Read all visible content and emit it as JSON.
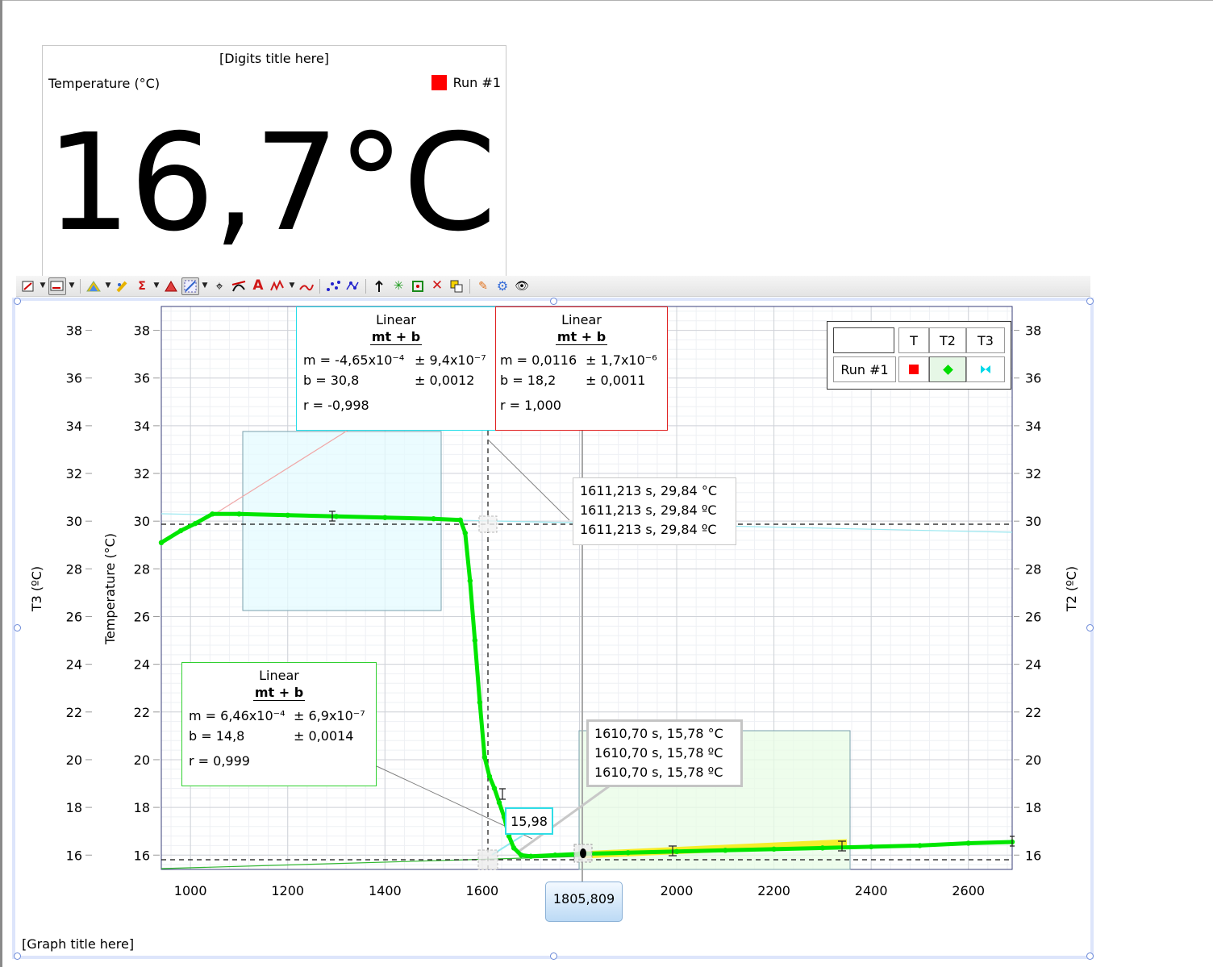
{
  "digits": {
    "title": "[Digits title here]",
    "label": "Temperature (°C)",
    "legend": "Run #1",
    "legend_color": "#ff0000",
    "value": "16,7°C"
  },
  "toolbar": {
    "icons": [
      "graph-options-icon",
      "autoscale-icon",
      "triangle-icon",
      "highlight-icon",
      "sigma-icon",
      "delta-icon",
      "select-region-icon",
      "crosshair-icon",
      "tangent-icon",
      "annotation-icon",
      "curve-fit-icon",
      "integral-icon",
      "show-data-icon",
      "connect-points-icon",
      "move-up-icon",
      "strip-chart-icon",
      "delete-icon",
      "copy-icon",
      "pin-icon",
      "settings-icon",
      "view-icon"
    ]
  },
  "graph": {
    "title": "[Graph title here]",
    "left_axis1_label": "T3 (ºC)",
    "left_axis2_label": "Temperature (°C)",
    "right_axis_label": "T2 (ºC)",
    "x_badge": "1805,809",
    "value_label": "15,98"
  },
  "fit_cyan": {
    "head": "Linear",
    "form": "mt + b",
    "m_label": "m = -4,65x10⁻⁴",
    "m_err": "± 9,4x10⁻⁷",
    "b_label": "b  = 30,8",
    "b_err": "± 0,0012",
    "r": "r = -0,998"
  },
  "fit_red": {
    "head": "Linear",
    "form": "mt + b",
    "m_label": "m = 0,0116",
    "m_err": "± 1,7x10⁻⁶",
    "b_label": "b  = 18,2",
    "b_err": "± 0,0011",
    "r": "r = 1,000"
  },
  "fit_green": {
    "head": "Linear",
    "form": "mt + b",
    "m_label": "m = 6,46x10⁻⁴",
    "m_err": "± 6,9x10⁻⁷",
    "b_label": "b  = 14,8",
    "b_err": "± 0,0014",
    "r": "r = 0,999"
  },
  "tooltip_top": [
    "1611,213 s, 29,84 °C",
    "1611,213 s, 29,84 ºC",
    "1611,213 s, 29,84 ºC"
  ],
  "tooltip_bottom": [
    "1610,70 s, 15,78 °C",
    "1610,70 s, 15,78 ºC",
    "1610,70 s, 15,78 ºC"
  ],
  "legend_table": {
    "headers": [
      "T",
      "T2",
      "T3"
    ],
    "row_label": "Run #1",
    "colors": {
      "T": "#ff0000",
      "T2": "#00dd00",
      "T3": "#00d8e8"
    }
  },
  "chart_data": {
    "type": "scatter",
    "xlim": [
      940,
      2690
    ],
    "ylim": [
      15.4,
      39
    ],
    "xticks": [
      1000,
      1200,
      1400,
      1600,
      1800,
      2000,
      2200,
      2400,
      2600
    ],
    "yticks": [
      16,
      18,
      20,
      22,
      24,
      26,
      28,
      30,
      32,
      34,
      36,
      38
    ],
    "grid": true,
    "legend_position": "top-right",
    "series": [
      {
        "name": "T",
        "color": "#00e600",
        "x": [
          940,
          980,
          1010,
          1045,
          1100,
          1200,
          1300,
          1400,
          1500,
          1555,
          1565,
          1575,
          1585,
          1595,
          1605,
          1615,
          1625,
          1635,
          1645,
          1655,
          1665,
          1680,
          1700,
          1750,
          1800,
          1900,
          2000,
          2100,
          2200,
          2300,
          2400,
          2500,
          2600,
          2690
        ],
        "y": [
          29.1,
          29.6,
          29.9,
          30.3,
          30.3,
          30.25,
          30.2,
          30.15,
          30.1,
          30.05,
          29.5,
          27.5,
          25.0,
          22.4,
          20.1,
          19.3,
          18.8,
          18.2,
          17.6,
          16.8,
          16.3,
          16.0,
          15.95,
          16.0,
          16.05,
          16.1,
          16.15,
          16.2,
          16.25,
          16.3,
          16.35,
          16.4,
          16.5,
          16.55
        ]
      }
    ]
  }
}
